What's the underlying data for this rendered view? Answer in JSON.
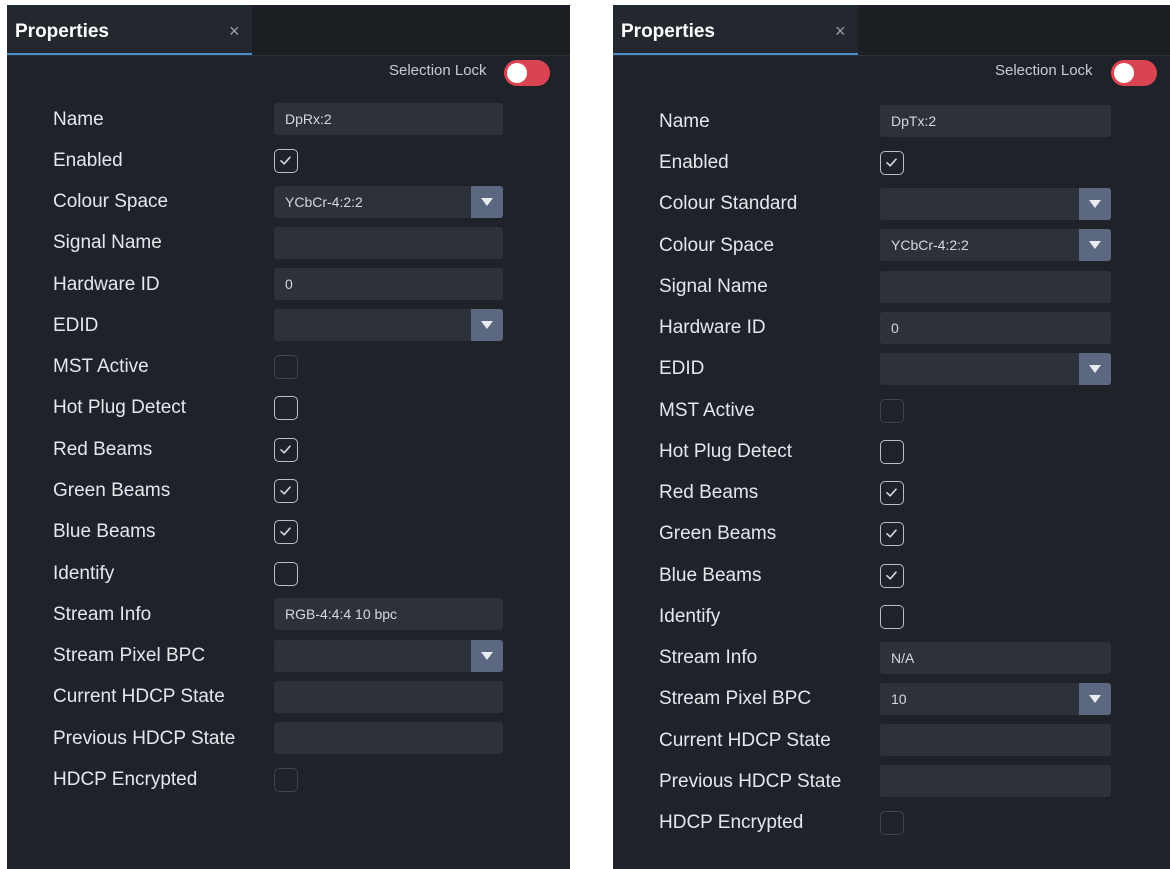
{
  "left": {
    "tab_title": "Properties",
    "close_glyph": "×",
    "selection_lock_label": "Selection Lock",
    "selection_lock_on": true,
    "name_label": "Name",
    "name_value": "DpRx:2",
    "enabled_label": "Enabled",
    "enabled_checked": true,
    "colour_space_label": "Colour Space",
    "colour_space_value": "YCbCr-4:2:2",
    "signal_name_label": "Signal Name",
    "signal_name_value": "",
    "hardware_id_label": "Hardware ID",
    "hardware_id_value": "0",
    "edid_label": "EDID",
    "edid_value": "",
    "mst_active_label": "MST Active",
    "mst_active_checked": false,
    "hot_plug_detect_label": "Hot Plug Detect",
    "hot_plug_detect_checked": false,
    "red_beams_label": "Red Beams",
    "red_beams_checked": true,
    "green_beams_label": "Green Beams",
    "green_beams_checked": true,
    "blue_beams_label": "Blue Beams",
    "blue_beams_checked": true,
    "identify_label": "Identify",
    "identify_checked": false,
    "stream_info_label": "Stream Info",
    "stream_info_value": "RGB-4:4:4 10 bpc",
    "stream_pixel_bpc_label": "Stream Pixel BPC",
    "stream_pixel_bpc_value": "",
    "current_hdcp_state_label": "Current HDCP State",
    "current_hdcp_state_value": "",
    "previous_hdcp_state_label": "Previous HDCP State",
    "previous_hdcp_state_value": "",
    "hdcp_encrypted_label": "HDCP Encrypted",
    "hdcp_encrypted_checked": false
  },
  "right": {
    "tab_title": "Properties",
    "close_glyph": "×",
    "selection_lock_label": "Selection Lock",
    "selection_lock_on": true,
    "name_label": "Name",
    "name_value": "DpTx:2",
    "enabled_label": "Enabled",
    "enabled_checked": true,
    "colour_standard_label": "Colour Standard",
    "colour_standard_value": "",
    "colour_space_label": "Colour Space",
    "colour_space_value": "YCbCr-4:2:2",
    "signal_name_label": "Signal Name",
    "signal_name_value": "",
    "hardware_id_label": "Hardware ID",
    "hardware_id_value": "0",
    "edid_label": "EDID",
    "edid_value": "",
    "mst_active_label": "MST Active",
    "mst_active_checked": false,
    "hot_plug_detect_label": "Hot Plug Detect",
    "hot_plug_detect_checked": false,
    "red_beams_label": "Red Beams",
    "red_beams_checked": true,
    "green_beams_label": "Green Beams",
    "green_beams_checked": true,
    "blue_beams_label": "Blue Beams",
    "blue_beams_checked": true,
    "identify_label": "Identify",
    "identify_checked": false,
    "stream_info_label": "Stream Info",
    "stream_info_value": "N/A",
    "stream_pixel_bpc_label": "Stream Pixel BPC",
    "stream_pixel_bpc_value": "10",
    "current_hdcp_state_label": "Current HDCP State",
    "current_hdcp_state_value": "",
    "previous_hdcp_state_label": "Previous HDCP State",
    "previous_hdcp_state_value": "",
    "hdcp_encrypted_label": "HDCP Encrypted",
    "hdcp_encrypted_checked": false
  },
  "colors": {
    "panel_bg": "#1f2329",
    "field_bg": "#2d3139",
    "select_arrow_bg": "#5b6880",
    "toggle_on": "#d94452",
    "tab_underline": "#4a8bc8",
    "label_text": "#e4e7eb"
  },
  "icons": {
    "tab_close": "close-icon",
    "dropdown": "chevron-down-icon",
    "checkbox_checked": "check-icon"
  }
}
